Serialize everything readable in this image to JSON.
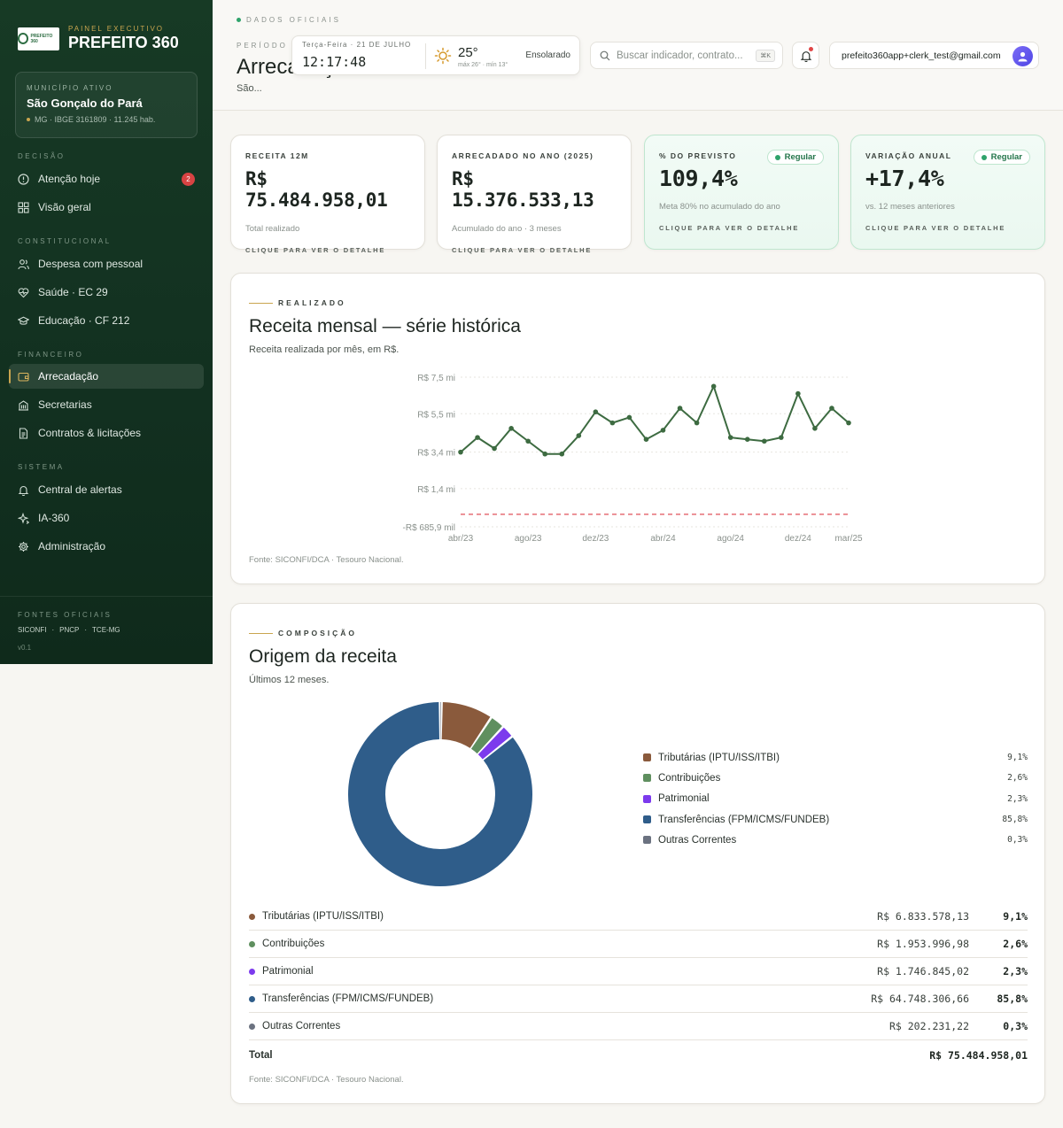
{
  "sidebar": {
    "brand_kicker": "PAINEL EXECUTIVO",
    "brand_name": "PREFEITO 360",
    "logo_text": "PREFEITO 360",
    "municipio": {
      "kicker": "MUNICÍPIO ATIVO",
      "name": "São Gonçalo do Pará",
      "meta": "MG · IBGE 3161809 · 11.245 hab."
    },
    "sections": {
      "decisao": "DECISÃO",
      "constitucional": "CONSTITUCIONAL",
      "financeiro": "FINANCEIRO",
      "sistema": "SISTEMA"
    },
    "items": {
      "atencao": {
        "label": "Atenção hoje",
        "badge": "2",
        "icon": "alert-circle-icon"
      },
      "visao": {
        "label": "Visão geral",
        "icon": "grid-icon"
      },
      "pessoal": {
        "label": "Despesa com pessoal",
        "icon": "users-icon"
      },
      "saude": {
        "label": "Saúde · EC 29",
        "icon": "heart-pulse-icon"
      },
      "educacao": {
        "label": "Educação · CF 212",
        "icon": "graduation-cap-icon"
      },
      "arrecadacao": {
        "label": "Arrecadação",
        "icon": "wallet-icon"
      },
      "secretarias": {
        "label": "Secretarias",
        "icon": "building-icon"
      },
      "contratos": {
        "label": "Contratos & licitações",
        "icon": "file-icon"
      },
      "alertas": {
        "label": "Central de alertas",
        "icon": "bell-icon"
      },
      "ia": {
        "label": "IA-360",
        "icon": "sparkles-icon"
      },
      "admin": {
        "label": "Administração",
        "icon": "gear-icon"
      }
    },
    "footer": {
      "kicker": "FONTES OFICIAIS",
      "links": [
        "SICONFI",
        "·",
        "PNCP",
        "·",
        "TCE-MG"
      ],
      "version": "v0.1"
    }
  },
  "header": {
    "dados": "DADOS OFICIAIS",
    "periodo": "PERÍODO M",
    "title": "Arrecadação",
    "subtitle": "São...",
    "clock": {
      "date": "Terça-Feira · 21 DE JULHO",
      "time": "12:17:48",
      "temp": "25°",
      "range": "máx 26° · mín 13°",
      "weather": "Ensolarado"
    },
    "search": {
      "placeholder": "Buscar indicador, contrato...",
      "shortcut": "⌘K"
    },
    "user_email": "prefeito360app+clerk_test@gmail.com"
  },
  "kpis": [
    {
      "label": "RECEITA 12M",
      "value": "R$ 75.484.958,01",
      "note": "Total realizado",
      "cta": "CLIQUE PARA VER O DETALHE"
    },
    {
      "label": "ARRECADADO NO ANO (2025)",
      "value": "R$ 15.376.533,13",
      "note": "Acumulado do ano · 3 meses",
      "cta": "CLIQUE PARA VER O DETALHE"
    },
    {
      "label": "% DO PREVISTO",
      "value": "109,4%",
      "note": "Meta 80% no acumulado do ano",
      "cta": "CLIQUE PARA VER O DETALHE",
      "badge": "Regular"
    },
    {
      "label": "VARIAÇÃO ANUAL",
      "value": "+17,4%",
      "note": "vs. 12 meses anteriores",
      "cta": "CLIQUE PARA VER O DETALHE",
      "badge": "Regular"
    }
  ],
  "serie": {
    "eyebrow": "REALIZADO",
    "title": "Receita mensal — série histórica",
    "subtitle": "Receita realizada por mês, em R$.",
    "fonte": "Fonte: SICONFI/DCA · Tesouro Nacional."
  },
  "composicao": {
    "eyebrow": "COMPOSIÇÃO",
    "title": "Origem da receita",
    "subtitle": "Últimos 12 meses.",
    "fonte": "Fonte: SICONFI/DCA · Tesouro Nacional.",
    "rows": [
      {
        "label": "Tributárias (IPTU/ISS/ITBI)",
        "value": "R$ 6.833.578,13",
        "pct": "9,1%"
      },
      {
        "label": "Contribuições",
        "value": "R$ 1.953.996,98",
        "pct": "2,6%"
      },
      {
        "label": "Patrimonial",
        "value": "R$ 1.746.845,02",
        "pct": "2,3%"
      },
      {
        "label": "Transferências (FPM/ICMS/FUNDEB)",
        "value": "R$ 64.748.306,66",
        "pct": "85,8%"
      },
      {
        "label": "Outras Correntes",
        "value": "R$ 202.231,22",
        "pct": "0,3%"
      }
    ],
    "total_label": "Total",
    "total_value": "R$ 75.484.958,01"
  },
  "chart_data": [
    {
      "type": "line",
      "ytick_labels": [
        "R$ 7,5 mi",
        "R$ 5,5 mi",
        "R$ 3,4 mi",
        "R$ 1,4 mi",
        "-R$ 685,9 mil"
      ],
      "yticks": [
        7.5,
        5.5,
        3.4,
        1.4,
        -0.6859
      ],
      "ylim": [
        -0.6859,
        7.5
      ],
      "xtick_labels": [
        "abr/23",
        "ago/23",
        "dez/23",
        "abr/24",
        "ago/24",
        "dez/24",
        "mar/25"
      ],
      "xtick_index": [
        0,
        4,
        8,
        12,
        16,
        20,
        23
      ],
      "reference_line": 0,
      "color": "#3d6b41",
      "ref_color": "#e0505a",
      "values": [
        3.4,
        4.2,
        3.6,
        4.7,
        4.0,
        3.3,
        3.3,
        4.3,
        5.6,
        5.0,
        5.3,
        4.1,
        4.6,
        5.8,
        5.0,
        7.0,
        4.2,
        4.1,
        4.0,
        4.2,
        6.6,
        4.7,
        5.8,
        5.0
      ],
      "grid": true
    },
    {
      "type": "pie",
      "donut": true,
      "categories": [
        "Tributárias (IPTU/ISS/ITBI)",
        "Contribuições",
        "Patrimonial",
        "Transferências (FPM/ICMS/FUNDEB)",
        "Outras Correntes"
      ],
      "values": [
        9.1,
        2.6,
        2.3,
        85.8,
        0.3
      ],
      "colors": [
        "#8a5a3c",
        "#5f8f5f",
        "#7c3aed",
        "#2f5d8a",
        "#6b7280"
      ],
      "legend": "right"
    }
  ]
}
